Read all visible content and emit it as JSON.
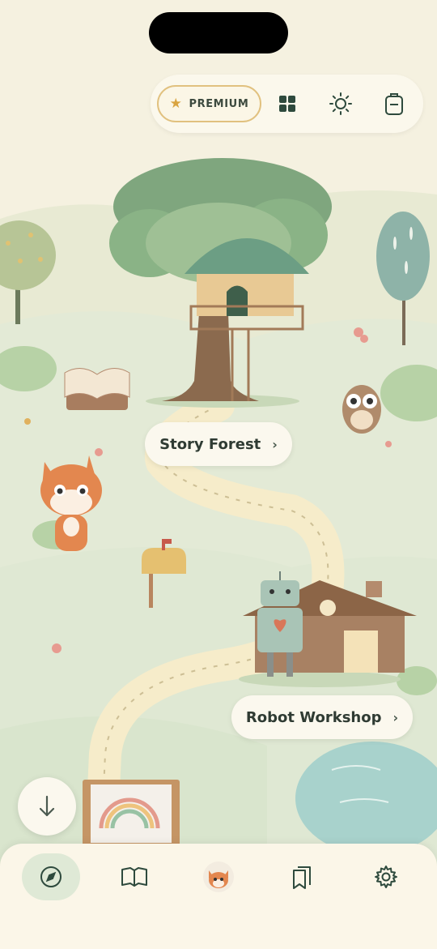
{
  "topbar": {
    "premium_label": "PREMIUM",
    "icons": [
      "star-icon",
      "grid-icon",
      "sun-icon",
      "backpack-icon"
    ]
  },
  "map": {
    "locations": [
      {
        "label": "Story Forest",
        "chevron": "›"
      },
      {
        "label": "Robot Workshop",
        "chevron": "›"
      }
    ]
  },
  "fab": {
    "icon": "arrow-down-icon"
  },
  "bottom_nav": {
    "items": [
      "compass-icon",
      "open-book-icon",
      "fox-avatar",
      "bookmarks-icon",
      "gear-icon"
    ],
    "active_index": 0
  },
  "colors": {
    "background": "#f5f1e0",
    "accent_green": "#dfe9d6",
    "premium_border": "#e1c17f",
    "text_dark": "#2f3b33"
  }
}
